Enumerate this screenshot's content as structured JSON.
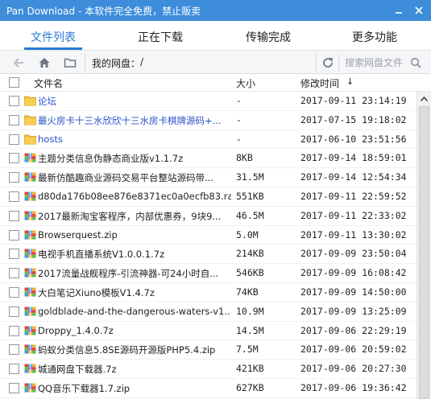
{
  "window": {
    "title": "Pan Download - 本软件完全免费，禁止贩卖",
    "minimize_icon": "minimize-icon",
    "close_icon": "close-icon",
    "title_bar_color": "#3d8ddb"
  },
  "tabs": [
    {
      "label": "文件列表",
      "active": true
    },
    {
      "label": "正在下载",
      "active": false
    },
    {
      "label": "传输完成",
      "active": false
    },
    {
      "label": "更多功能",
      "active": false
    }
  ],
  "toolbar": {
    "back_icon": "arrow-left-icon",
    "home_icon": "home-icon",
    "folder_icon": "folder-icon",
    "path_label": "我的网盘：",
    "path_value": "/",
    "refresh_icon": "refresh-icon",
    "search_placeholder": "搜索网盘文件",
    "search_icon": "search-icon"
  },
  "header": {
    "name": "文件名",
    "size": "大小",
    "time": "修改时间",
    "sort_indicator": "↓"
  },
  "files": [
    {
      "type": "folder",
      "name": "论坛",
      "size": "-",
      "time": "2017-09-11 23:14:19"
    },
    {
      "type": "folder",
      "name": "最火房卡十三水欣欣十三水房卡棋牌源码+...",
      "size": "-",
      "time": "2017-07-15 19:18:02"
    },
    {
      "type": "folder",
      "name": "hosts",
      "size": "-",
      "time": "2017-06-10 23:51:56"
    },
    {
      "type": "file",
      "name": "主题分类信息伪静态商业版v1.1.7z",
      "size": "8KB",
      "time": "2017-09-14 18:59:01"
    },
    {
      "type": "file",
      "name": "最新仿酷趣商业源码交易平台整站源码带...",
      "size": "31.5M",
      "time": "2017-09-14 12:54:34"
    },
    {
      "type": "file",
      "name": "d80da176b08ee876e8371ec0a0ecfb83.rar",
      "size": "551KB",
      "time": "2017-09-11 22:59:52"
    },
    {
      "type": "file",
      "name": "2017最新淘宝客程序，内部优惠券，9块9...",
      "size": "46.5M",
      "time": "2017-09-11 22:33:02"
    },
    {
      "type": "file",
      "name": "Browserquest.zip",
      "size": "5.0M",
      "time": "2017-09-11 13:30:02"
    },
    {
      "type": "file",
      "name": "电视手机直播系统V1.0.0.1.7z",
      "size": "214KB",
      "time": "2017-09-09 23:50:04"
    },
    {
      "type": "file",
      "name": "2017流量战舰程序-引流神器-可24小时自...",
      "size": "546KB",
      "time": "2017-09-09 16:08:42"
    },
    {
      "type": "file",
      "name": "大白笔记Xiuno模板V1.4.7z",
      "size": "74KB",
      "time": "2017-09-09 14:50:00"
    },
    {
      "type": "file",
      "name": "goldblade-and-the-dangerous-waters-v1...",
      "size": "10.9M",
      "time": "2017-09-09 13:25:09"
    },
    {
      "type": "file",
      "name": "Droppy_1.4.0.7z",
      "size": "14.5M",
      "time": "2017-09-06 22:29:19"
    },
    {
      "type": "file",
      "name": "蚂蚁分类信息5.8SE源码开源版PHP5.4.zip",
      "size": "7.5M",
      "time": "2017-09-06 20:59:02"
    },
    {
      "type": "file",
      "name": "城通网盘下载器.7z",
      "size": "421KB",
      "time": "2017-09-06 20:27:30"
    },
    {
      "type": "file",
      "name": "QQ音乐下载器1.7.zip",
      "size": "627KB",
      "time": "2017-09-06 19:36:42"
    }
  ],
  "icons": {
    "folder_row": "folder-icon",
    "file_row": "archive-icon",
    "scroll_up": "chevron-up-icon"
  },
  "colors": {
    "accent": "#2a7ad6",
    "folder_link": "#2a50c8",
    "folder_yellow": "#f5c242"
  }
}
